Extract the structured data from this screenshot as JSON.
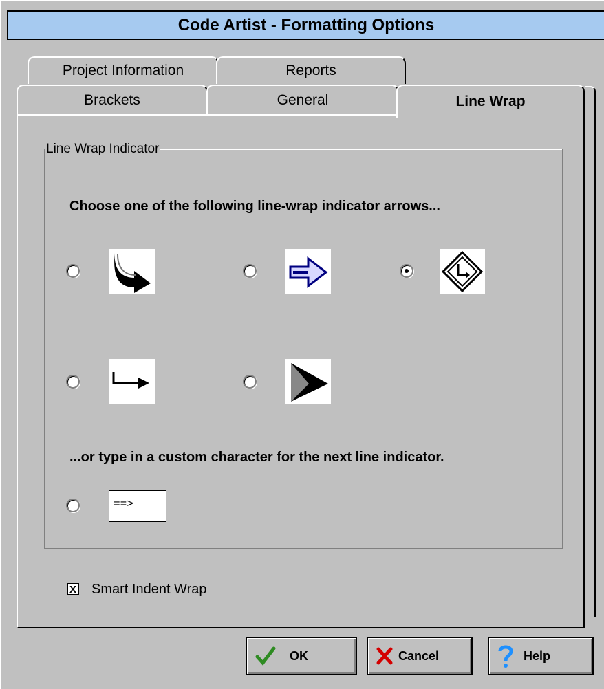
{
  "window": {
    "title": "Code Artist - Formatting Options"
  },
  "tabs": {
    "back_row": [
      {
        "label": "Project Information"
      },
      {
        "label": "Reports"
      }
    ],
    "front_row": [
      {
        "label": "Brackets"
      },
      {
        "label": "General"
      },
      {
        "label": "Line Wrap"
      }
    ],
    "active": "Line Wrap"
  },
  "group": {
    "legend": "Line Wrap Indicator",
    "prompt": "Choose one of the following line-wrap indicator arrows...",
    "options": [
      {
        "icon": "curved-arrow-icon",
        "selected": false
      },
      {
        "icon": "hollow-blue-arrow-icon",
        "selected": false
      },
      {
        "icon": "diamond-turn-sign-icon",
        "selected": true
      },
      {
        "icon": "hook-arrow-icon",
        "selected": false
      },
      {
        "icon": "triangle-pointer-icon",
        "selected": false
      }
    ],
    "custom_prompt": "...or type in a custom character for the next line indicator.",
    "custom": {
      "selected": false,
      "value": "==>"
    }
  },
  "smart_indent": {
    "label": "Smart Indent Wrap",
    "checked": true,
    "mark": "X"
  },
  "buttons": {
    "ok": {
      "label": "OK",
      "icon": "checkmark-icon"
    },
    "cancel": {
      "label": "Cancel",
      "icon": "x-icon"
    },
    "help": {
      "label": "Help",
      "icon": "question-icon"
    }
  },
  "colors": {
    "title_bg": "#a6caf0",
    "face": "#c0c0c0",
    "help_blue": "#1e90ff",
    "ok_green": "#2e8b22",
    "cancel_red": "#d40000"
  }
}
